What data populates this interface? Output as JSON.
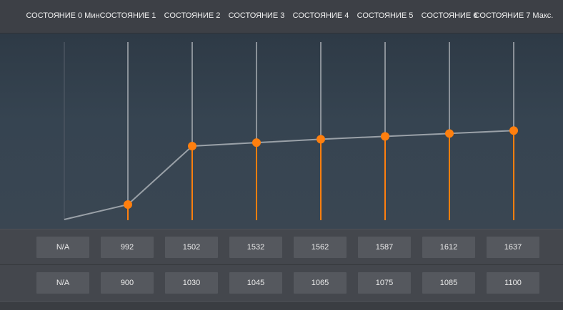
{
  "states": [
    {
      "label": "СОСТОЯНИЕ 0 Мин",
      "value1": "N/A",
      "value2": "N/A"
    },
    {
      "label": "СОСТОЯНИЕ 1",
      "value1": "992",
      "value2": "900"
    },
    {
      "label": "СОСТОЯНИЕ 2",
      "value1": "1502",
      "value2": "1030"
    },
    {
      "label": "СОСТОЯНИЕ 3",
      "value1": "1532",
      "value2": "1045"
    },
    {
      "label": "СОСТОЯНИЕ 4",
      "value1": "1562",
      "value2": "1065"
    },
    {
      "label": "СОСТОЯНИЕ 5",
      "value1": "1587",
      "value2": "1075"
    },
    {
      "label": "СОСТОЯНИЕ 6",
      "value1": "1612",
      "value2": "1085"
    },
    {
      "label": "СОСТОЯНИЕ 7 Макс.",
      "value1": "1637",
      "value2": "1100"
    }
  ],
  "chart_data": {
    "type": "line",
    "categories": [
      "0",
      "1",
      "2",
      "3",
      "4",
      "5",
      "6",
      "7"
    ],
    "values": [
      null,
      992,
      1502,
      1532,
      1562,
      1587,
      1612,
      1637
    ]
  },
  "colors": {
    "accent": "#ff7f0e",
    "line": "#9aa1a8",
    "stem": "#a8adb3"
  }
}
